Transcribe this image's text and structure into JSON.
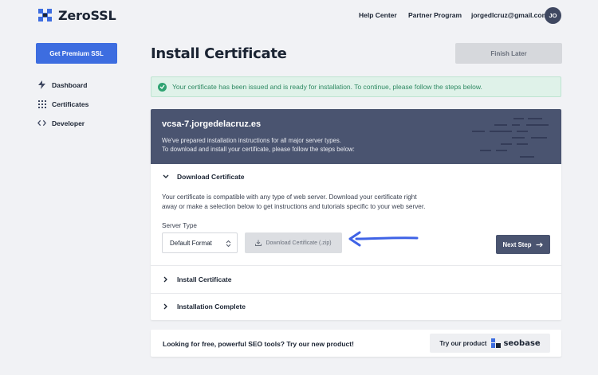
{
  "header": {
    "logo_text": "ZeroSSL",
    "nav": {
      "help": "Help Center",
      "partner": "Partner Program",
      "email": "jorgedlcruz@gmail.com"
    },
    "avatar_initials": "JO"
  },
  "sidebar": {
    "premium_label": "Get Premium SSL",
    "items": [
      {
        "label": "Dashboard",
        "icon": "bolt-icon"
      },
      {
        "label": "Certificates",
        "icon": "grid-icon"
      },
      {
        "label": "Developer",
        "icon": "code-icon"
      }
    ]
  },
  "main": {
    "title": "Install Certificate",
    "finish_label": "Finish Later",
    "alert_text": "Your certificate has been issued and is ready for installation. To continue, please follow the steps below."
  },
  "card": {
    "domain": "vcsa-7.jorgedelacruz.es",
    "sub_line1": "We've prepared installation instructions for all major server types.",
    "sub_line2": "To download and install your certificate, please follow the steps below:",
    "sections": {
      "download": "Download Certificate",
      "install": "Install Certificate",
      "complete": "Installation Complete"
    },
    "desc_line1": "Your certificate is compatible with any type of web server. Download your certificate right",
    "desc_line2": "away or make a selection below to get instructions and tutorials specific to your web server.",
    "server_type_label": "Server Type",
    "server_type_value": "Default Format",
    "download_label": "Download Certificate (.zip)",
    "next_label": "Next Step"
  },
  "promo": {
    "text": "Looking for free, powerful SEO tools? Try our new product!",
    "button_label": "Try our product",
    "brand": "seobase"
  },
  "colors": {
    "accent_blue": "#3d6de0",
    "header_slate": "#4a5470",
    "success_green": "#2fa372",
    "arrow_blue": "#3f63e6"
  }
}
